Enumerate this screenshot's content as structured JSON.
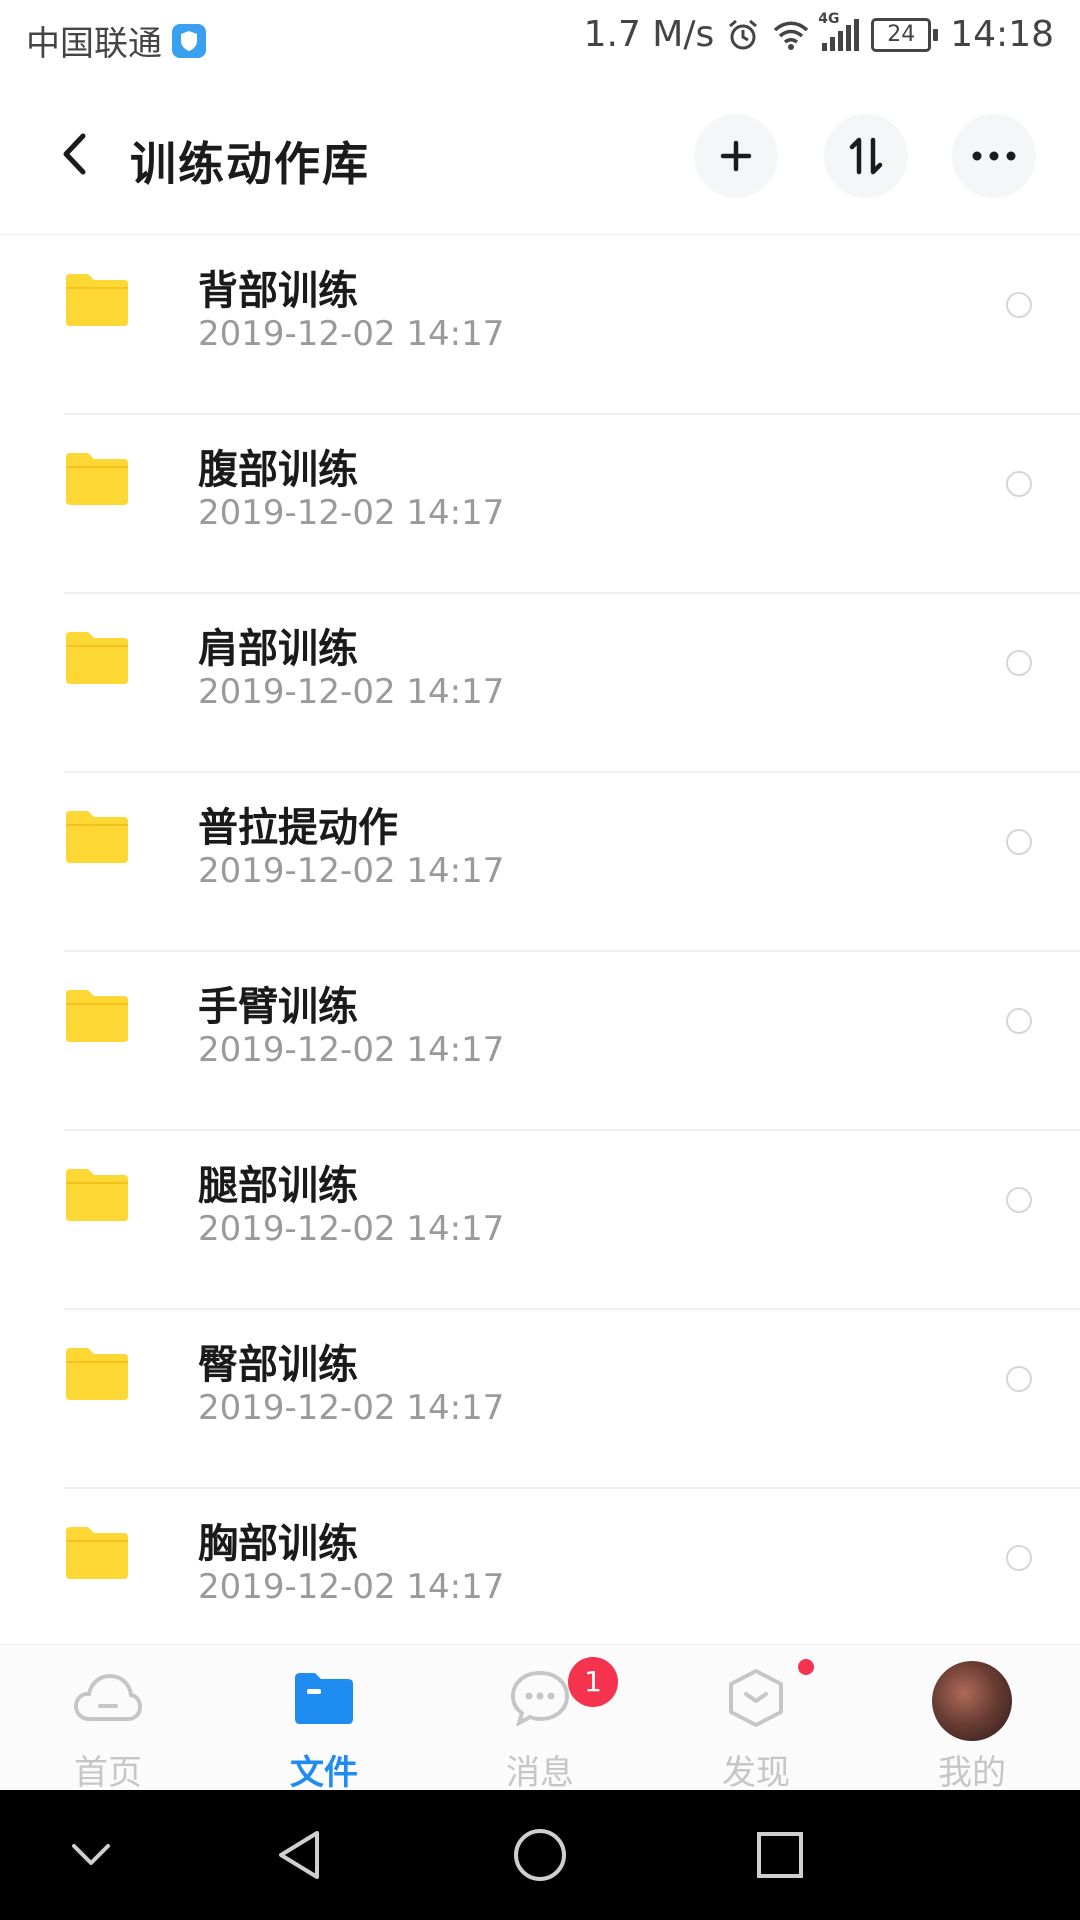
{
  "status_bar": {
    "carrier": "中国联通",
    "speed": "1.7 M/s",
    "network": "4G",
    "battery": "24",
    "time": "14:18"
  },
  "header": {
    "title": "训练动作库"
  },
  "files": [
    {
      "name": "背部训练",
      "date": "2019-12-02  14:17"
    },
    {
      "name": "腹部训练",
      "date": "2019-12-02  14:17"
    },
    {
      "name": "肩部训练",
      "date": "2019-12-02  14:17"
    },
    {
      "name": "普拉提动作",
      "date": "2019-12-02  14:17"
    },
    {
      "name": "手臂训练",
      "date": "2019-12-02  14:17"
    },
    {
      "name": "腿部训练",
      "date": "2019-12-02  14:17"
    },
    {
      "name": "臀部训练",
      "date": "2019-12-02  14:17"
    },
    {
      "name": "胸部训练",
      "date": "2019-12-02  14:17"
    }
  ],
  "tabs": [
    {
      "label": "首页",
      "icon": "cloud-icon"
    },
    {
      "label": "文件",
      "icon": "folder-icon",
      "active": true
    },
    {
      "label": "消息",
      "icon": "chat-icon",
      "badge": "1"
    },
    {
      "label": "发现",
      "icon": "discover-icon"
    },
    {
      "label": "我的",
      "icon": "avatar"
    }
  ],
  "colors": {
    "accent": "#1f8cf2",
    "folder": "#fdd835",
    "badge": "#f5334f"
  }
}
